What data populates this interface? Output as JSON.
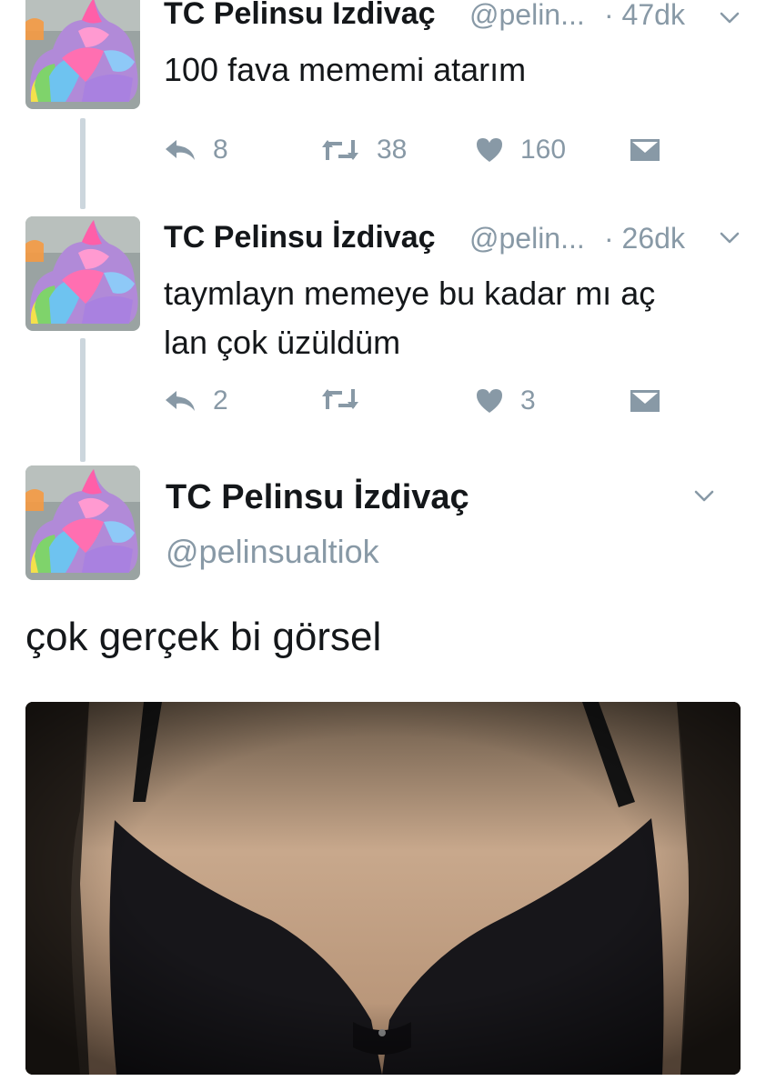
{
  "colors": {
    "muted": "#8899a6",
    "text": "#14171a",
    "thread_line": "#ccd6dd"
  },
  "tweets": [
    {
      "name": "TC Pelinsu Izdivaç",
      "handle": "@pelin...",
      "time": "· 47dk",
      "text": "100 fava mememi atarım",
      "replies": "8",
      "retweets": "38",
      "likes": "160",
      "icons": [
        "reply-icon",
        "retweet-icon",
        "like-icon",
        "dm-icon",
        "chevron-down-icon"
      ]
    },
    {
      "name": "TC Pelinsu İzdivaç",
      "handle": "@pelin...",
      "time": "· 26dk",
      "text_line1": "taymlayn memeye bu kadar mı aç",
      "text_line2": "lan çok üzüldüm",
      "replies": "2",
      "retweets": "",
      "likes": "3",
      "icons": [
        "reply-icon",
        "retweet-icon",
        "like-icon",
        "dm-icon",
        "chevron-down-icon"
      ]
    }
  ],
  "main_tweet": {
    "name": "TC Pelinsu İzdivaç",
    "handle": "@pelinsualtiok",
    "text": "çok gerçek bi görsel",
    "icons": [
      "chevron-down-icon"
    ]
  }
}
